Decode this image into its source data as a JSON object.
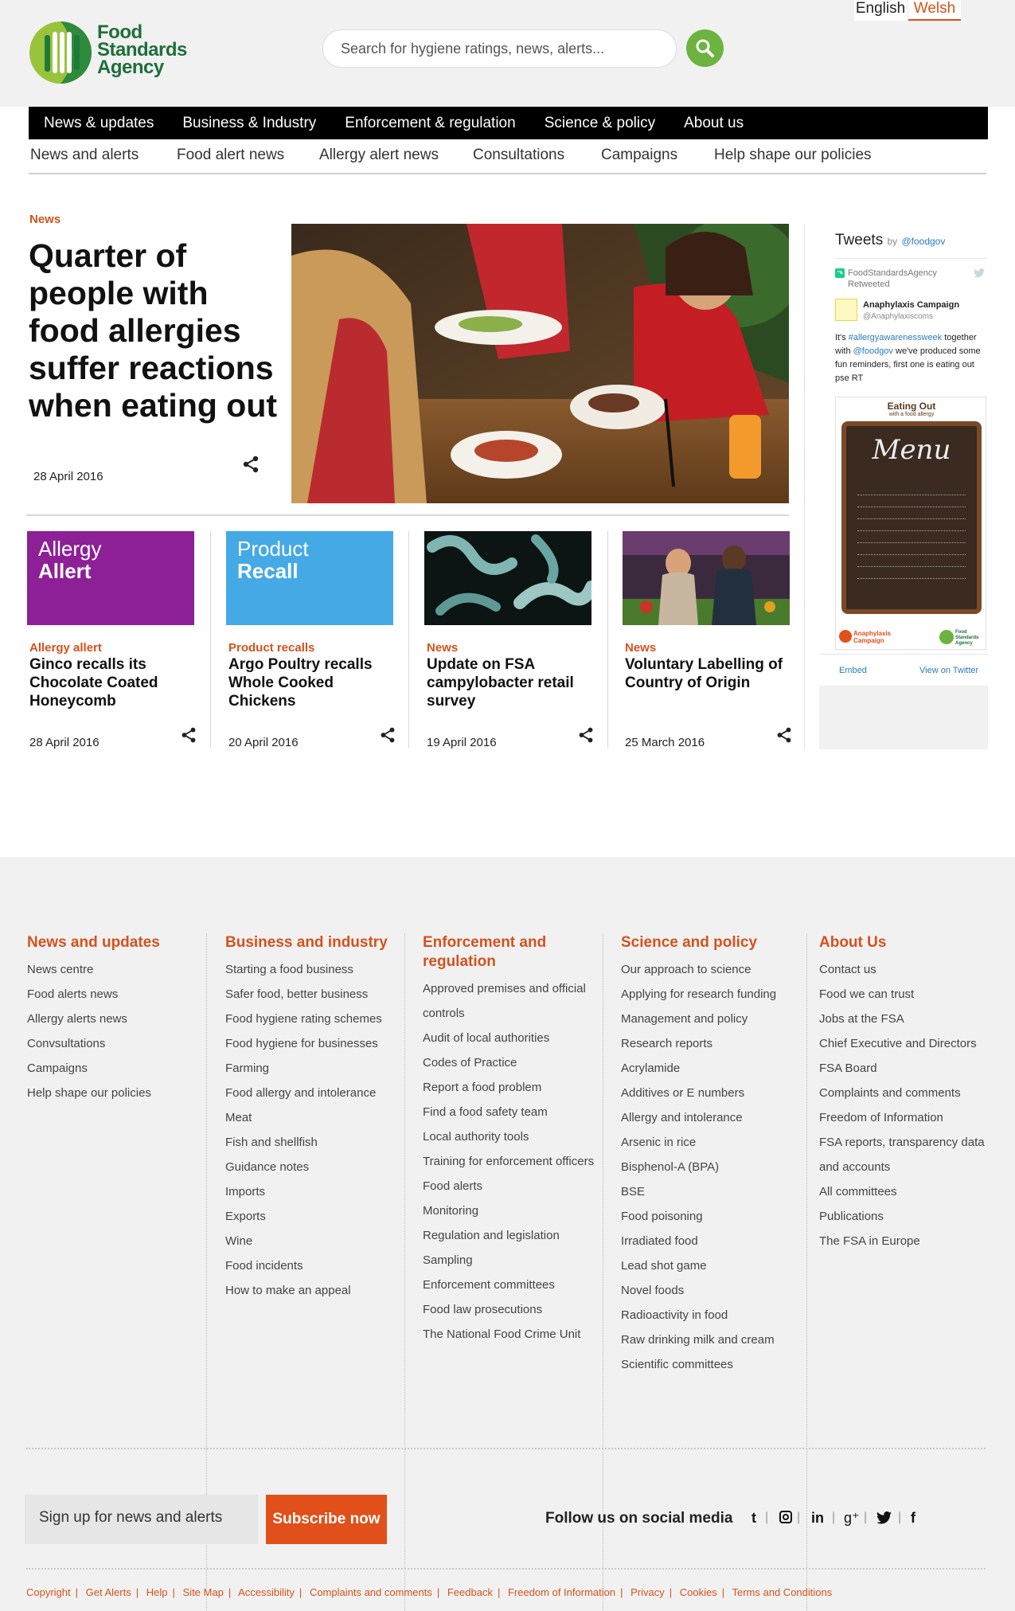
{
  "header": {
    "lang_english": "English",
    "lang_welsh": "Welsh",
    "logo_text": [
      "Food",
      "Standards",
      "Agency"
    ],
    "search_placeholder": "Search for hygiene ratings, news, alerts..."
  },
  "main_nav": [
    "News & updates",
    "Business & Industry",
    "Enforcement & regulation",
    "Science & policy",
    "About us"
  ],
  "sub_nav": [
    "News and alerts",
    "Food alert news",
    "Allergy alert news",
    "Consultations",
    "Campaigns",
    "Help shape our policies"
  ],
  "hero": {
    "kicker": "News",
    "title": "Quarter of people with food allergies suffer reactions when eating out",
    "date": "28 April 2016"
  },
  "cards": [
    {
      "block_label": [
        "Allergy",
        "Allert"
      ],
      "kicker": "Allergy allert",
      "title": "Ginco recalls its Chocolate Coated Honeycomb",
      "date": "28 April 2016"
    },
    {
      "block_label": [
        "Product",
        "Recall"
      ],
      "kicker": "Product recalls",
      "title": "Argo Poultry recalls Whole Cooked Chickens",
      "date": "20 April 2016"
    },
    {
      "kicker": "News",
      "title": "Update on FSA campylobacter retail survey",
      "date": "19 April 2016"
    },
    {
      "kicker": "News",
      "title": "Voluntary Labelling of Country of Origin",
      "date": "25 March 2016"
    }
  ],
  "tweets": {
    "title": "Tweets",
    "by": "by",
    "handle": "@foodgov",
    "retweeter": "FoodStandardsAgency",
    "retweeted": "Retweeted",
    "author": "Anaphylaxis Campaign",
    "author_handle": "@Anaphylaxiscoms",
    "text_prefix": "It's ",
    "hashtag": "#allergyawarenessweek",
    "text_mid": " together with ",
    "mention": "@foodgov",
    "text_suffix": " we've produced some fun reminders, first one is eating out  pse RT",
    "card_title": "Eating Out",
    "card_subtitle": "with a food allergy",
    "menu_word": "Menu",
    "card_brand_1": "Anaphylaxis",
    "card_brand_2": "Campaign",
    "card_brand_3": "Food Standards Agency",
    "embed": "Embed",
    "view": "View on Twitter",
    "colors": {
      "link": "#2b7bb9"
    }
  },
  "footer": {
    "columns": [
      {
        "heading": "News and updates",
        "links": [
          "News centre",
          "Food alerts news",
          "Allergy alerts news",
          "Convsultations",
          "Campaigns",
          "Help shape our policies"
        ]
      },
      {
        "heading": "Business and industry",
        "links": [
          "Starting a food business",
          "Safer food, better business",
          "Food hygiene rating schemes",
          "Food hygiene for businesses",
          "Farming",
          "Food allergy and intolerance",
          "Meat",
          "Fish and shellfish",
          "Guidance notes",
          "Imports",
          "Exports",
          "Wine",
          "Food incidents",
          "How to make an appeal"
        ]
      },
      {
        "heading": "Enforcement and regulation",
        "links": [
          "Approved premises and official controls",
          "Audit of local authorities",
          "Codes of Practice",
          "Report a food problem",
          "Find a food safety team",
          "Local authority tools",
          "Training for enforcement officers",
          "Food alerts",
          "Monitoring",
          "Regulation and legislation",
          "Sampling",
          "Enforcement committees",
          "Food law prosecutions",
          "The National Food Crime Unit"
        ]
      },
      {
        "heading": "Science and policy",
        "links": [
          "Our approach to science",
          "Applying for research funding",
          "Management and policy",
          "Research reports",
          "Acrylamide",
          "Additives or E numbers",
          "Allergy and intolerance",
          "Arsenic in rice",
          "Bisphenol-A (BPA)",
          "BSE",
          "Food poisoning",
          "Irradiated food",
          "Lead shot game",
          "Novel foods",
          "Radioactivity in food",
          "Raw drinking milk and cream",
          "Scientific committees"
        ]
      },
      {
        "heading": "About Us",
        "links": [
          "Contact us",
          "Food we can trust",
          "Jobs at the FSA",
          "Chief Executive and Directors",
          "FSA Board",
          "Complaints and comments",
          "Freedom of Information",
          "FSA reports, transparency data and accounts",
          "All committees",
          "Publications",
          "The FSA in Europe"
        ]
      }
    ],
    "signup_placeholder": "Sign up for news and alerts",
    "subscribe_label": "Subscribe now",
    "social_label": "Follow us on social media",
    "social_icons": [
      "tumblr-icon",
      "instagram-icon",
      "linkedin-icon",
      "google-plus-icon",
      "twitter-icon",
      "facebook-icon"
    ],
    "legal": [
      "Copyright",
      "Get Alerts",
      "Help",
      "Site Map",
      "Accessibility",
      "Complaints and comments",
      "Feedback",
      "Freedom of Information",
      "Privacy",
      "Cookies",
      "Terms and Conditions"
    ]
  },
  "colors": {
    "accent": "#d4521c",
    "brand_green": "#6db33f",
    "allergy_purple": "#8d2096",
    "recall_blue": "#45a9e6"
  }
}
